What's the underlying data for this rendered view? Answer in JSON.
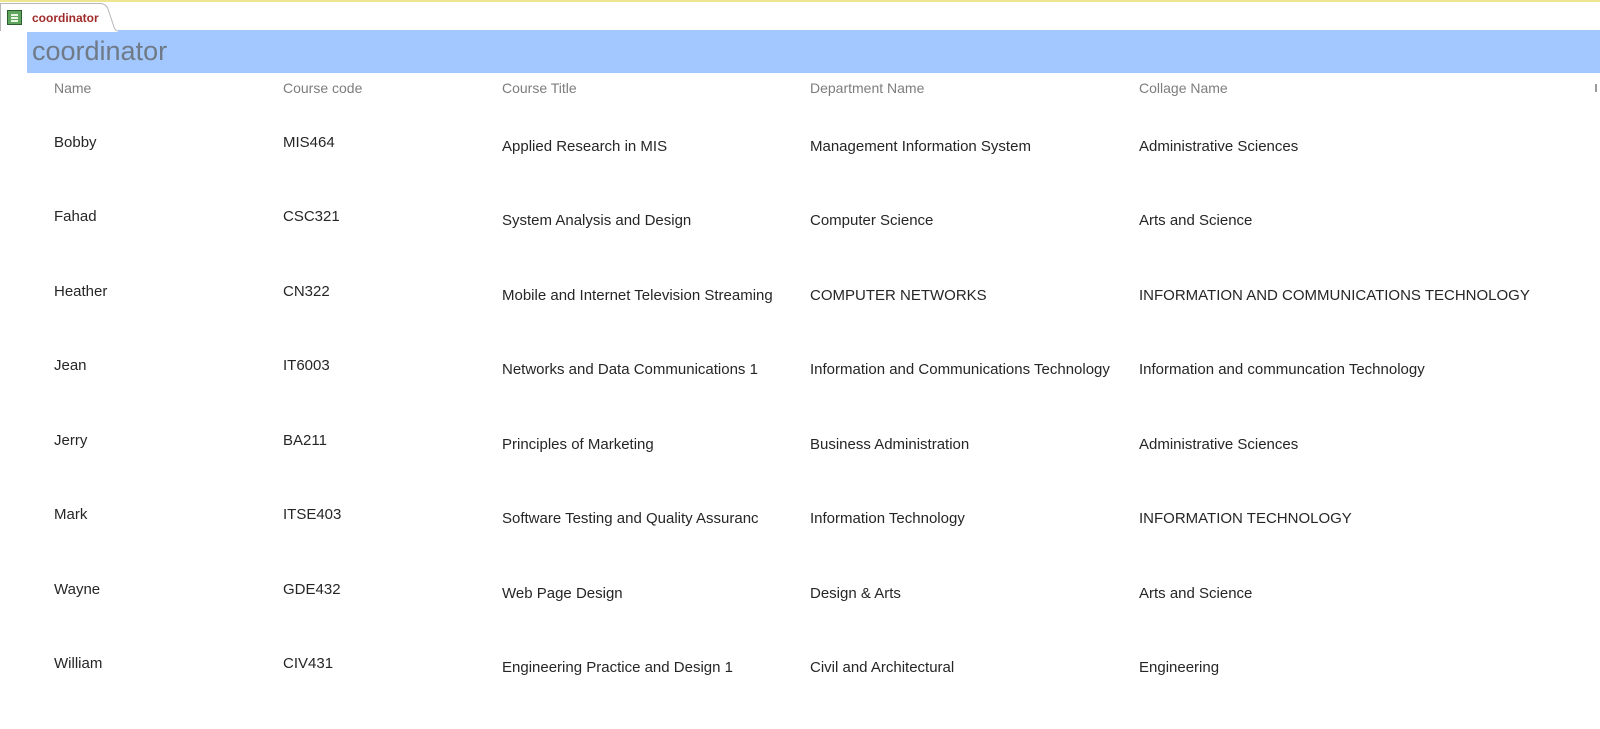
{
  "document_tab": {
    "label": "coordinator",
    "icon": "form-icon"
  },
  "form": {
    "title": "coordinator"
  },
  "columns": {
    "name": "Name",
    "course_code": "Course code",
    "course_title": "Course Title",
    "department_name": "Department Name",
    "collage_name": "Collage Name"
  },
  "records": [
    {
      "name": "Bobby",
      "course_code": "MIS464",
      "course_title": "Applied Research in MIS",
      "department_name": "Management Information System",
      "collage_name": "Administrative Sciences"
    },
    {
      "name": "Fahad",
      "course_code": "CSC321",
      "course_title": "System Analysis and Design",
      "department_name": "Computer Science",
      "collage_name": "Arts and Science"
    },
    {
      "name": "Heather",
      "course_code": "CN322",
      "course_title": "Mobile and Internet Television Streaming",
      "department_name": "COMPUTER NETWORKS",
      "collage_name": "INFORMATION AND COMMUNICATIONS TECHNOLOGY"
    },
    {
      "name": "Jean",
      "course_code": "IT6003",
      "course_title": "Networks and Data Communications 1",
      "department_name": "Information and Communications Technology",
      "collage_name": "Information and communcation Technology"
    },
    {
      "name": "Jerry",
      "course_code": "BA211",
      "course_title": "Principles of Marketing",
      "department_name": "Business Administration",
      "collage_name": "Administrative Sciences"
    },
    {
      "name": "Mark",
      "course_code": "ITSE403",
      "course_title": "Software Testing and Quality Assuranc",
      "department_name": "Information Technology",
      "collage_name": "INFORMATION TECHNOLOGY"
    },
    {
      "name": "Wayne",
      "course_code": "GDE432",
      "course_title": "Web Page Design",
      "department_name": "Design & Arts",
      "collage_name": "Arts and Science"
    },
    {
      "name": "William",
      "course_code": "CIV431",
      "course_title": "Engineering Practice and Design 1",
      "department_name": "Civil and Architectural",
      "collage_name": "Engineering"
    }
  ]
}
